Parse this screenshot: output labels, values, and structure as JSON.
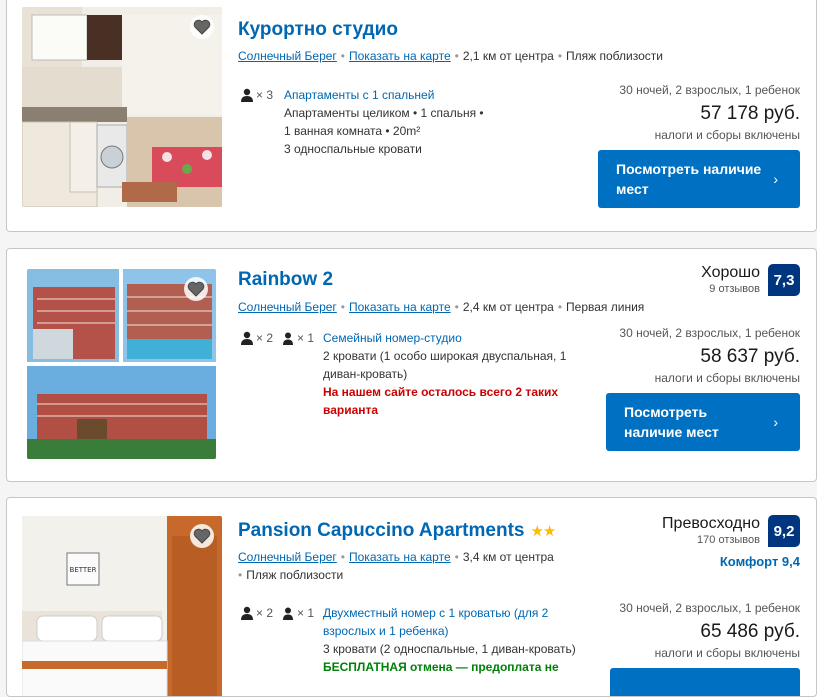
{
  "cards": [
    {
      "title": "Курортно студио",
      "location": {
        "city": "Солнечный Берег",
        "map": "Показать на карте",
        "distance": "2,1 км от центра",
        "extra": "Пляж поблизости"
      },
      "occupancy": {
        "adults": "× 3"
      },
      "room": {
        "type": "Апартаменты с 1 спальней",
        "line1": "Апартаменты целиком  • 1 спальня •",
        "line2": "1 ванная комната • 20m²",
        "line3": "3 односпальные кровати"
      },
      "nights": "30 ночей, 2 взрослых, 1 ребенок",
      "price": "57 178 руб.",
      "taxes": "налоги и сборы включены",
      "button": {
        "line1": "Посмотреть наличие",
        "line2": "мест"
      }
    },
    {
      "title": "Rainbow 2",
      "location": {
        "city": "Солнечный Берег",
        "map": "Показать на карте",
        "distance": "2,4 км от центра",
        "extra": "Первая линия"
      },
      "review": {
        "word": "Хорошо",
        "count": "9 отзывов",
        "score": "7,3"
      },
      "occupancy": {
        "adults": "× 2",
        "children": "× 1"
      },
      "room": {
        "type": "Семейный номер-студио",
        "line1": "2 кровати (1 особо широкая двуспальная, 1",
        "line2": "диван-кровать)",
        "warn1": "На нашем сайте осталось всего 2 таких",
        "warn2": "варианта"
      },
      "nights": "30 ночей, 2 взрослых, 1 ребенок",
      "price": "58 637 руб.",
      "taxes": "налоги и сборы включены",
      "button": {
        "line1": "Посмотреть",
        "line2": "наличие мест"
      }
    },
    {
      "title": "Pansion Capuccino Apartments",
      "stars": "★★",
      "location": {
        "city": "Солнечный Берег",
        "map": "Показать на карте",
        "distance": "3,4 км от центра",
        "extra": "Пляж поблизости"
      },
      "review": {
        "word": "Превосходно",
        "count": "170 отзывов",
        "score": "9,2",
        "comfort": "Комфорт 9,4"
      },
      "occupancy": {
        "adults": "× 2",
        "children": "× 1"
      },
      "room": {
        "type1": "Двухместный номер с 1 кроватью (для 2",
        "type2": "взрослых и 1 ребенка)",
        "line1": "3 кровати (2 односпальные, 1 диван-кровать)",
        "free": "БЕСПЛАТНАЯ отмена — предоплата не"
      },
      "nights": "30 ночей, 2 взрослых, 1 ребенок",
      "price": "65 486 руб.",
      "taxes": "налоги и сборы включены",
      "photo_sign": "BETTER"
    }
  ],
  "colors": {
    "link": "#0067b3",
    "button": "#0071c2",
    "badge": "#003580",
    "star": "#febb02",
    "warn": "#cc0000",
    "free": "#008009"
  }
}
